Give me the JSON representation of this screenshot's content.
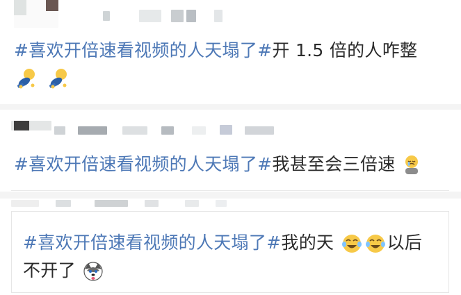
{
  "posts": [
    {
      "hashtag": "#喜欢开倍速看视频的人天塌了#",
      "body_line1": "开 1.5 倍的人咋整",
      "body_line2": "",
      "emojis": [
        "sweat-kneel-icon",
        "sweat-kneel-icon"
      ]
    },
    {
      "hashtag": "#喜欢开倍速看视频的人天塌了#",
      "body_line1": "我甚至会三倍速",
      "emojis": [
        "crying-sit-icon"
      ]
    },
    {
      "hashtag": "#喜欢开倍速看视频的人天塌了#",
      "body_mid": "我的天",
      "body_end": "以后",
      "body_line2": "不开了",
      "emojis": [
        "laugh-cry-icon",
        "laugh-cry-icon",
        "husky-face-icon"
      ]
    }
  ],
  "colors": {
    "hashtag": "#4d78b6",
    "text": "#2b2b2b",
    "background": "#f4f4f4",
    "card": "#ffffff"
  }
}
